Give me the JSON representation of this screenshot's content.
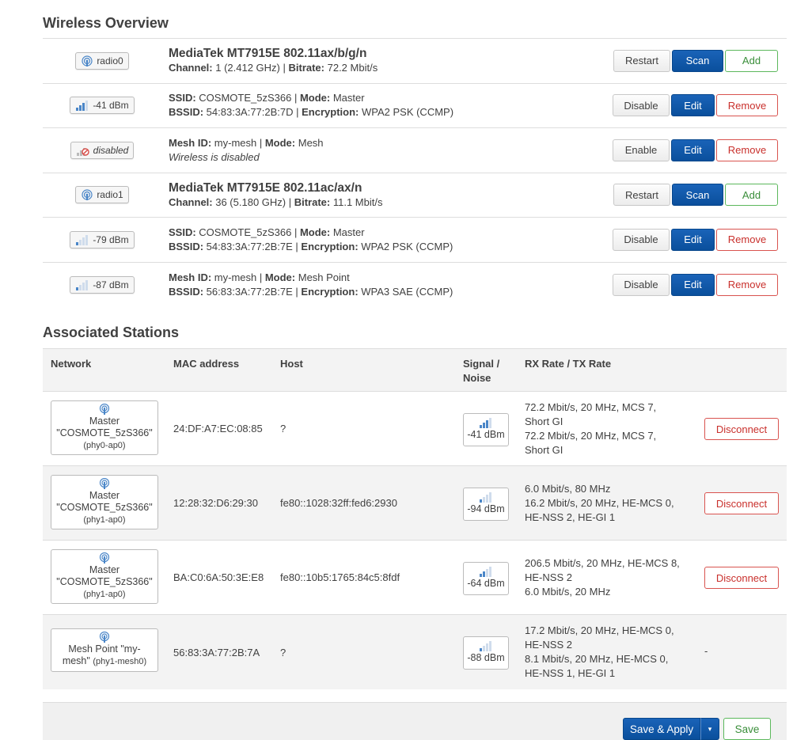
{
  "wireless_overview": {
    "title": "Wireless Overview",
    "rows": [
      {
        "badge": "radio0",
        "badge_type": "radio",
        "line1_title": "MediaTek MT7915E 802.11ax/b/g/n",
        "l2k1": "Channel:",
        "l2v1": " 1 (2.412 GHz) | ",
        "l2k2": "Bitrate:",
        "l2v2": " 72.2 Mbit/s",
        "btn1": "Restart",
        "btn2": "Scan",
        "btn3": "Add"
      },
      {
        "badge": "-41 dBm",
        "badge_type": "signal",
        "signal_level": 3,
        "l1k1": "SSID:",
        "l1v1": " COSMOTE_5zS366 | ",
        "l1k2": "Mode:",
        "l1v2": " Master",
        "l2k1": "BSSID:",
        "l2v1": " 54:83:3A:77:2B:7D | ",
        "l2k2": "Encryption:",
        "l2v2": " WPA2 PSK (CCMP)",
        "btn1": "Disable",
        "btn2": "Edit",
        "btn3": "Remove"
      },
      {
        "badge": "disabled",
        "badge_type": "disabled",
        "l1k1": "Mesh ID:",
        "l1v1": " my-mesh | ",
        "l1k2": "Mode:",
        "l1v2": " Mesh",
        "note": "Wireless is disabled",
        "btn1": "Enable",
        "btn2": "Edit",
        "btn3": "Remove"
      },
      {
        "badge": "radio1",
        "badge_type": "radio",
        "line1_title": "MediaTek MT7915E 802.11ac/ax/n",
        "l2k1": "Channel:",
        "l2v1": " 36 (5.180 GHz) | ",
        "l2k2": "Bitrate:",
        "l2v2": " 11.1 Mbit/s",
        "btn1": "Restart",
        "btn2": "Scan",
        "btn3": "Add"
      },
      {
        "badge": "-79 dBm",
        "badge_type": "signal",
        "signal_level": 1,
        "l1k1": "SSID:",
        "l1v1": " COSMOTE_5zS366 | ",
        "l1k2": "Mode:",
        "l1v2": " Master",
        "l2k1": "BSSID:",
        "l2v1": " 54:83:3A:77:2B:7E | ",
        "l2k2": "Encryption:",
        "l2v2": " WPA2 PSK (CCMP)",
        "btn1": "Disable",
        "btn2": "Edit",
        "btn3": "Remove"
      },
      {
        "badge": "-87 dBm",
        "badge_type": "signal",
        "signal_level": 1,
        "l1k1": "Mesh ID:",
        "l1v1": " my-mesh | ",
        "l1k2": "Mode:",
        "l1v2": " Mesh Point",
        "l2k1": "BSSID:",
        "l2v1": " 56:83:3A:77:2B:7E | ",
        "l2k2": "Encryption:",
        "l2v2": " WPA3 SAE (CCMP)",
        "btn1": "Disable",
        "btn2": "Edit",
        "btn3": "Remove"
      }
    ]
  },
  "associated_stations": {
    "title": "Associated Stations",
    "headers": {
      "network": "Network",
      "mac": "MAC address",
      "host": "Host",
      "signal_l1": "Signal /",
      "signal_l2": "Noise",
      "rates": "RX Rate / TX Rate"
    },
    "rows": [
      {
        "net_l1": "Master",
        "net_l2": "\"COSMOTE_5zS366\"",
        "net_l3": "(phy0-ap0)",
        "mac": "24:DF:A7:EC:08:85",
        "host": "?",
        "signal": "-41 dBm",
        "signal_level": 3,
        "rate1": "72.2 Mbit/s, 20 MHz, MCS 7,",
        "rate2": "Short GI",
        "rate3": "72.2 Mbit/s, 20 MHz, MCS 7,",
        "rate4": "Short GI",
        "action": "Disconnect"
      },
      {
        "net_l1": "Master",
        "net_l2": "\"COSMOTE_5zS366\"",
        "net_l3": "(phy1-ap0)",
        "mac": "12:28:32:D6:29:30",
        "host": "fe80::1028:32ff:fed6:2930",
        "signal": "-94 dBm",
        "signal_level": 1,
        "rate1": "6.0 Mbit/s, 80 MHz",
        "rate2": "16.2 Mbit/s, 20 MHz, HE-MCS 0,",
        "rate3": "HE-NSS 2, HE-GI 1",
        "rate4": "",
        "action": "Disconnect"
      },
      {
        "net_l1": "Master",
        "net_l2": "\"COSMOTE_5zS366\"",
        "net_l3": "(phy1-ap0)",
        "mac": "BA:C0:6A:50:3E:E8",
        "host": "fe80::10b5:1765:84c5:8fdf",
        "signal": "-64 dBm",
        "signal_level": 2,
        "rate1": "206.5 Mbit/s, 20 MHz, HE-MCS 8,",
        "rate2": "HE-NSS 2",
        "rate3": "6.0 Mbit/s, 20 MHz",
        "rate4": "",
        "action": "Disconnect"
      },
      {
        "net_l1": "Mesh Point \"my-",
        "net_l2": "mesh\"",
        "net_l3": "(phy1-mesh0)",
        "mac": "56:83:3A:77:2B:7A",
        "host": "?",
        "signal": "-88 dBm",
        "signal_level": 1,
        "rate1": "17.2 Mbit/s, 20 MHz, HE-MCS 0,",
        "rate2": "HE-NSS 2",
        "rate3": "8.1 Mbit/s, 20 MHz, HE-MCS 0,",
        "rate4": "HE-NSS 1, HE-GI 1",
        "action": "-"
      }
    ]
  },
  "footer": {
    "save_apply": "Save & Apply",
    "dropdown": "▾",
    "save": "Save"
  },
  "colors": {
    "primary": "#0a4f9c",
    "positive": "#5cb85c",
    "negative": "#d9534f",
    "signal": "#4a86c8"
  }
}
